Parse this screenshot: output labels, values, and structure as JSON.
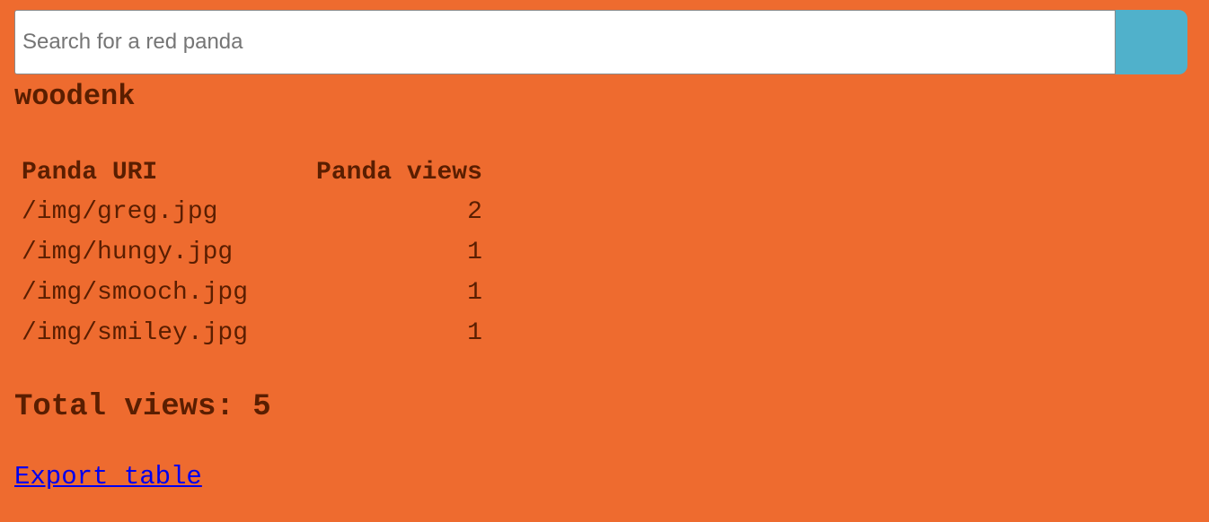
{
  "search": {
    "placeholder": "Search for a red panda",
    "value": ""
  },
  "user": {
    "name": "woodenk"
  },
  "table": {
    "headers": [
      "Panda URI",
      "Panda views"
    ],
    "rows": [
      {
        "uri": "/img/greg.jpg",
        "views": "2"
      },
      {
        "uri": "/img/hungy.jpg",
        "views": "1"
      },
      {
        "uri": "/img/smooch.jpg",
        "views": "1"
      },
      {
        "uri": "/img/smiley.jpg",
        "views": "1"
      }
    ]
  },
  "total": {
    "label": "Total views:",
    "value": "5"
  },
  "export": {
    "label": "Export table"
  },
  "colors": {
    "background": "#EE6B2F",
    "text": "#5A1E00",
    "search_button": "#50B1CB",
    "link": "#0000EE"
  }
}
